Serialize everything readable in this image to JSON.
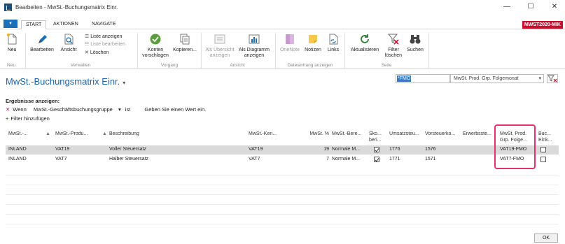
{
  "window": {
    "title": "Bearbeiten - MwSt.-Buchungsmatrix Einr.",
    "minimize": "—",
    "maximize": "☐",
    "close": "✕"
  },
  "ribbon_tabs": [
    "START",
    "AKTIONEN",
    "NAVIGATE"
  ],
  "company": "MWST2020-MIK",
  "ribbon": {
    "neu": "Neu",
    "bearbeiten": "Bearbeiten",
    "ansicht": "Ansicht",
    "liste_anzeigen": "Liste anzeigen",
    "liste_bearbeiten": "Liste bearbeiten",
    "loeschen": "Löschen",
    "konten_vorschlagen_1": "Konten",
    "konten_vorschlagen_2": "vorschlagen",
    "kopieren": "Kopieren...",
    "als_uebersicht_1": "Als Übersicht",
    "als_uebersicht_2": "anzeigen",
    "als_diagramm_1": "Als Diagramm",
    "als_diagramm_2": "anzeigen",
    "onenote": "OneNote",
    "notizen": "Notizen",
    "links": "Links",
    "aktualisieren": "Aktualisieren",
    "filter_loeschen_1": "Filter",
    "filter_loeschen_2": "löschen",
    "suchen": "Suchen",
    "groups": {
      "neu": "Neu",
      "verwalten": "Verwalten",
      "vorgang": "Vorgang",
      "ansicht": "Ansicht",
      "dateianhang": "Dateianhang anzeigen",
      "seite": "Seite"
    }
  },
  "page": {
    "title": "MwSt.-Buchungsmatrix Einr.",
    "title_caret": "▾",
    "search_value": "*FMO",
    "filter_field": "MwSt. Prod. Grp. Folgemonat",
    "filter_field_caret": "▾"
  },
  "filter": {
    "results_label": "Ergebnisse anzeigen:",
    "remove_icon": "✕",
    "wenn": "Wenn",
    "field": "MwSt.-Geschäftsbuchungsgruppe",
    "field_caret": "▾",
    "operator": "ist",
    "value_prompt": "Geben Sie einen Wert ein.",
    "add_icon": "+",
    "add_filter": "Filter hinzufügen"
  },
  "table": {
    "headers": {
      "c1": "MwSt.-...",
      "c2": "MwSt.-Produ...",
      "c3": "Beschreibung",
      "c4": "MwSt.-Ken...",
      "c5": "MwSt. %",
      "c6": "MwSt.-Bere...",
      "c7a": "Sko...",
      "c7b": "beri...",
      "c8": "Umsatzsteu...",
      "c9": "Vorsteuerko...",
      "c10": "Erwerbsste...",
      "c11a": "MwSt. Prod.",
      "c11b": "Grp. Folge...",
      "c12a": "Buc...",
      "c12b": "Eink..."
    },
    "rows": [
      {
        "bus": "INLAND",
        "prod": "VAT19",
        "desc": "Voller Steuersatz",
        "ident": "VAT19",
        "pct": "19",
        "calc": "Normale M...",
        "skonto": true,
        "sales": "1776",
        "purch": "1576",
        "reverse": "",
        "next": "VAT19-FMO",
        "bucheink": false
      },
      {
        "bus": "INLAND",
        "prod": "VAT7",
        "desc": "Halber Steuersatz",
        "ident": "VAT7",
        "pct": "7",
        "calc": "Normale M...",
        "skonto": true,
        "sales": "1771",
        "purch": "1571",
        "reverse": "",
        "next": "VAT7-FMO",
        "bucheink": false
      }
    ]
  },
  "ok_button": "OK",
  "colors": {
    "accent_blue": "#1f63a8",
    "company_red": "#c8102e",
    "highlight_pink": "#e2336b"
  }
}
